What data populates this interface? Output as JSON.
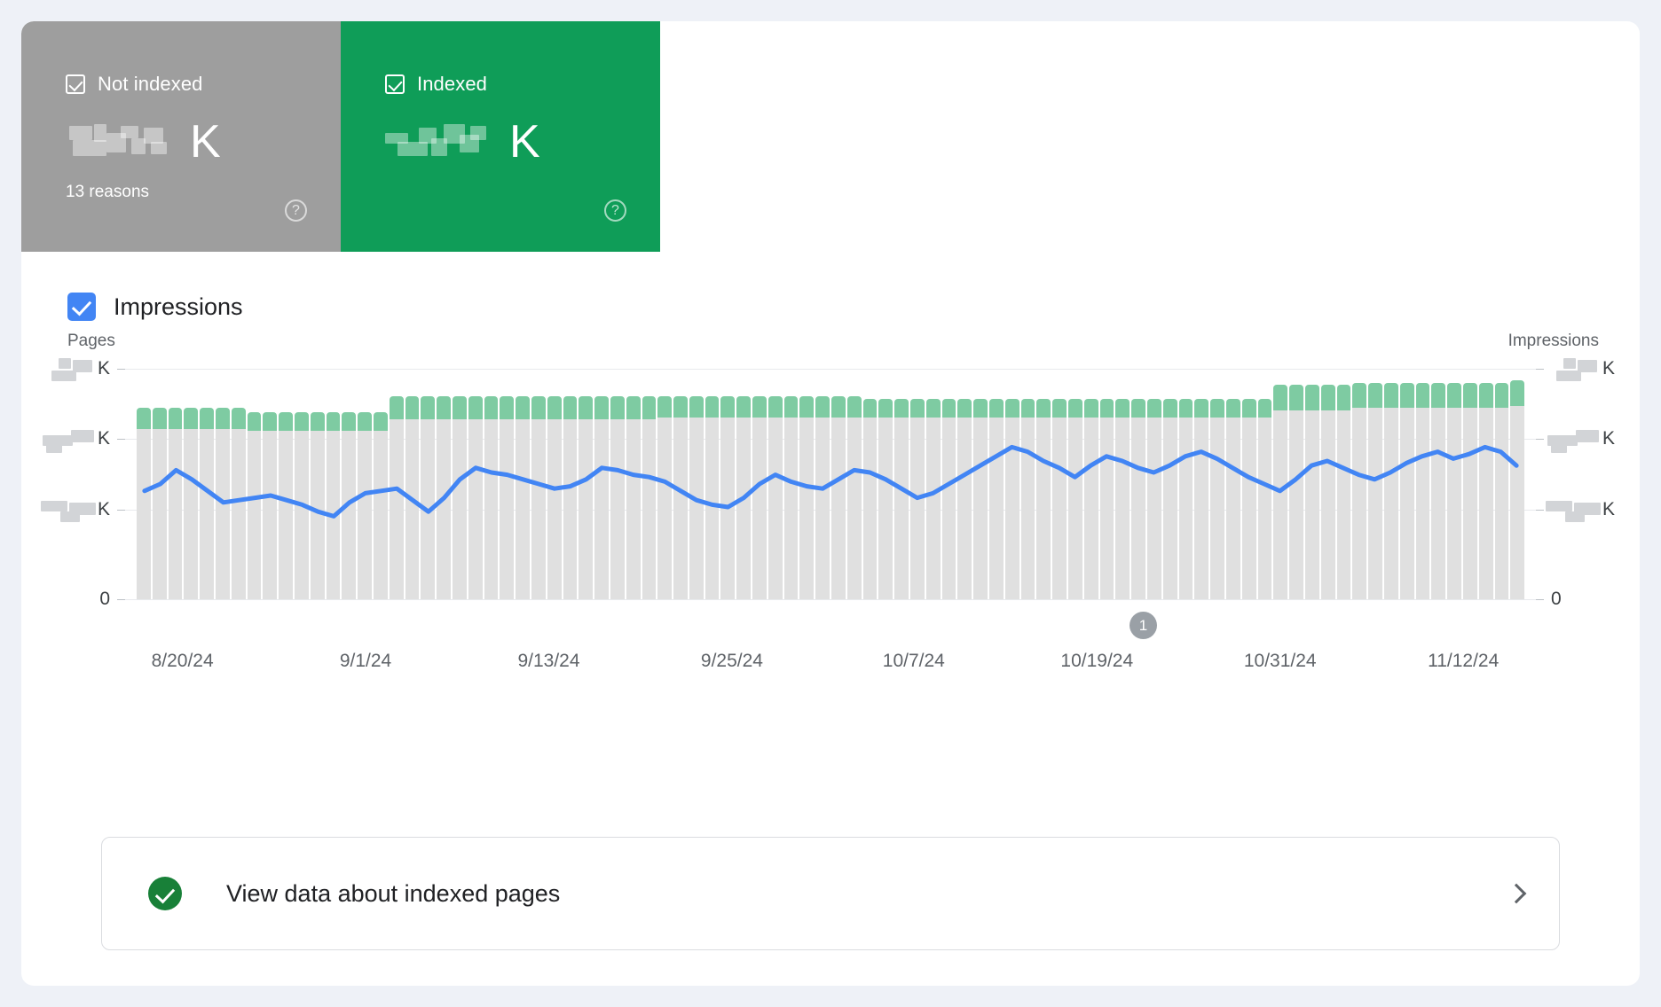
{
  "cards": [
    {
      "id": "not-indexed",
      "label": "Not indexed",
      "value_suffix": "K",
      "value_redacted": true,
      "sub": "13 reasons",
      "help": "?",
      "color": "#9e9e9e"
    },
    {
      "id": "indexed",
      "label": "Indexed",
      "value_suffix": "K",
      "value_redacted": true,
      "sub": "",
      "help": "?",
      "color": "#0f9d58"
    }
  ],
  "legend": {
    "impressions_label": "Impressions",
    "impressions_checked": true,
    "impressions_color": "#4285f4"
  },
  "annotation": {
    "badge": "1"
  },
  "footer_link": {
    "text": "View data about indexed pages",
    "icon": "check-circle",
    "icon_color": "#188038",
    "chevron": "chevron-right-icon"
  },
  "chart_data": {
    "type": "bar",
    "title": "",
    "ylabel": "Pages",
    "ylabel_right": "Impressions",
    "xlabel": "",
    "grid": true,
    "legend_position": "top-left",
    "left_axis_ticks": [
      "K",
      "K",
      "K",
      "0"
    ],
    "left_axis_ticks_redacted": [
      true,
      true,
      true,
      false
    ],
    "right_axis_ticks": [
      "K",
      "K",
      "K",
      "0"
    ],
    "right_axis_ticks_redacted": [
      true,
      true,
      true,
      false
    ],
    "x_tick_labels": [
      "8/20/24",
      "9/1/24",
      "9/13/24",
      "9/25/24",
      "10/7/24",
      "10/19/24",
      "10/31/24",
      "11/12/24"
    ],
    "x_tick_positions": [
      0.033,
      0.165,
      0.297,
      0.429,
      0.56,
      0.692,
      0.824,
      0.956
    ],
    "series": [
      {
        "name": "Not indexed",
        "color": "#e0e0e0",
        "values": [
          74,
          74,
          74,
          74,
          74,
          74,
          74,
          73,
          73,
          73,
          73,
          73,
          73,
          73,
          73,
          73,
          78,
          78,
          78,
          78,
          78,
          78,
          78,
          78,
          78,
          78,
          78,
          78,
          78,
          78,
          78,
          78,
          78,
          79,
          79,
          79,
          79,
          79,
          79,
          79,
          79,
          79,
          79,
          79,
          79,
          79,
          79,
          79,
          79,
          79,
          79,
          79,
          79,
          79,
          79,
          79,
          79,
          79,
          79,
          79,
          79,
          79,
          79,
          79,
          79,
          79,
          79,
          79,
          79,
          79,
          79,
          79,
          82,
          82,
          82,
          82,
          82,
          83,
          83,
          83,
          83,
          83,
          83,
          83,
          83,
          83,
          83,
          84
        ]
      },
      {
        "name": "Indexed",
        "color": "#7ecba2",
        "values": [
          9,
          9,
          9,
          9,
          9,
          9,
          9,
          8,
          8,
          8,
          8,
          8,
          8,
          8,
          8,
          8,
          10,
          10,
          10,
          10,
          10,
          10,
          10,
          10,
          10,
          10,
          10,
          10,
          10,
          10,
          10,
          10,
          10,
          9,
          9,
          9,
          9,
          9,
          9,
          9,
          9,
          9,
          9,
          9,
          9,
          9,
          8,
          8,
          8,
          8,
          8,
          8,
          8,
          8,
          8,
          8,
          8,
          8,
          8,
          8,
          8,
          8,
          8,
          8,
          8,
          8,
          8,
          8,
          8,
          8,
          8,
          8,
          11,
          11,
          11,
          11,
          11,
          11,
          11,
          11,
          11,
          11,
          11,
          11,
          11,
          11,
          11,
          11
        ]
      },
      {
        "name": "Impressions",
        "color": "#4285f4",
        "type": "line",
        "values": [
          47,
          50,
          56,
          52,
          47,
          42,
          43,
          44,
          45,
          43,
          41,
          38,
          36,
          42,
          46,
          47,
          48,
          43,
          38,
          44,
          52,
          57,
          55,
          54,
          52,
          50,
          48,
          49,
          52,
          57,
          56,
          54,
          53,
          51,
          47,
          43,
          41,
          40,
          44,
          50,
          54,
          51,
          49,
          48,
          52,
          56,
          55,
          52,
          48,
          44,
          46,
          50,
          54,
          58,
          62,
          66,
          64,
          60,
          57,
          53,
          58,
          62,
          60,
          57,
          55,
          58,
          62,
          64,
          61,
          57,
          53,
          50,
          47,
          52,
          58,
          60,
          57,
          54,
          52,
          55,
          59,
          62,
          64,
          61,
          63,
          66,
          64,
          58
        ]
      }
    ]
  }
}
